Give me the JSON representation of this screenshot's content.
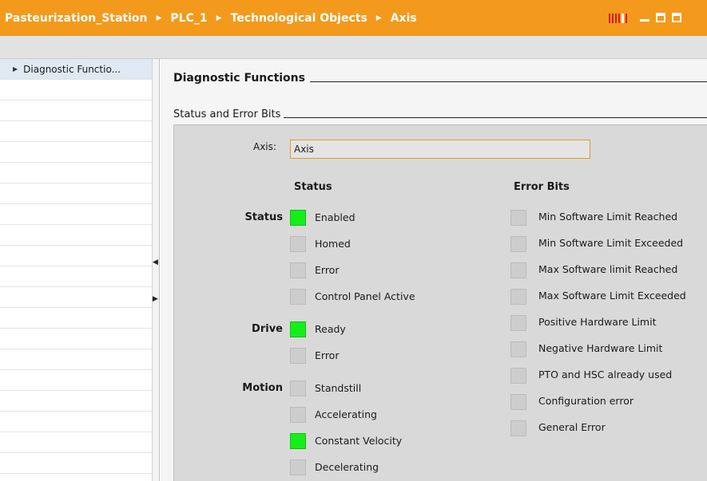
{
  "breadcrumb": [
    "Pasteurization_Station",
    "PLC_1",
    "Technological Objects",
    "Axis"
  ],
  "colors": {
    "title_bar": "#f39a1c",
    "led_on": "#16ee1c",
    "led_off": "#cdcdcd",
    "input_border": "#e39b23"
  },
  "tree": {
    "items": [
      {
        "label": "Diagnostic Functio..."
      }
    ]
  },
  "section_title": "Diagnostic Functions",
  "subsection_title": "Status and Error Bits",
  "axis": {
    "label": "Axis:",
    "value": "Axis"
  },
  "status_header": "Status",
  "error_header": "Error Bits",
  "status_groups": [
    {
      "name": "Status",
      "items": [
        {
          "label": "Enabled",
          "on": true
        },
        {
          "label": "Homed",
          "on": false
        },
        {
          "label": "Error",
          "on": false
        },
        {
          "label": "Control Panel Active",
          "on": false
        }
      ]
    },
    {
      "name": "Drive",
      "items": [
        {
          "label": "Ready",
          "on": true
        },
        {
          "label": "Error",
          "on": false
        }
      ]
    },
    {
      "name": "Motion",
      "items": [
        {
          "label": "Standstill",
          "on": false
        },
        {
          "label": "Accelerating",
          "on": false
        },
        {
          "label": "Constant Velocity",
          "on": true
        },
        {
          "label": "Decelerating",
          "on": false
        }
      ]
    }
  ],
  "error_bits": [
    {
      "label": "Min Software Limit Reached",
      "on": false
    },
    {
      "label": "Min Software Limit Exceeded",
      "on": false
    },
    {
      "label": "Max Software limit Reached",
      "on": false
    },
    {
      "label": "Max Software Limit Exceeded",
      "on": false
    },
    {
      "label": "Positive Hardware Limit",
      "on": false
    },
    {
      "label": "Negative Hardware Limit",
      "on": false
    },
    {
      "label": "PTO and HSC already used",
      "on": false
    },
    {
      "label": "Configuration error",
      "on": false
    },
    {
      "label": "General Error",
      "on": false
    }
  ]
}
